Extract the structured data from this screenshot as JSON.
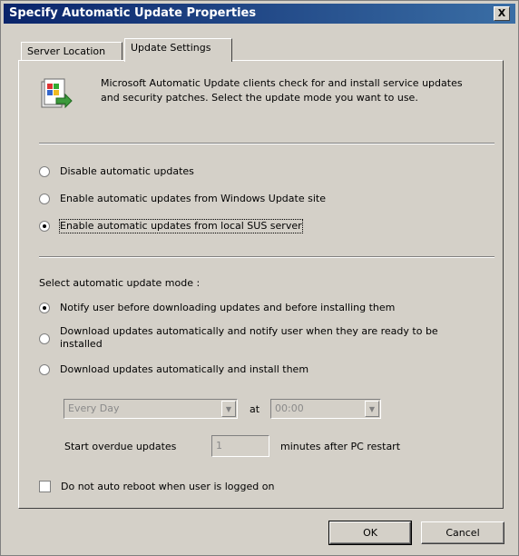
{
  "window": {
    "title": "Specify Automatic Update Properties",
    "close_label": "X"
  },
  "tabs": [
    {
      "label": "Server Location",
      "active": false
    },
    {
      "label": "Update Settings",
      "active": true
    }
  ],
  "intro": {
    "icon": "windows-update-icon",
    "text": "Microsoft Automatic Update clients check for and install service updates and security patches. Select the update mode you want to use."
  },
  "source_options": [
    {
      "label": "Disable automatic updates",
      "checked": false
    },
    {
      "label": "Enable automatic updates from Windows Update site",
      "checked": false
    },
    {
      "label": "Enable automatic updates from local SUS server",
      "checked": true
    }
  ],
  "mode_section": {
    "label": "Select automatic update mode :",
    "options": [
      {
        "label": "Notify user before downloading updates and before installing them",
        "checked": true
      },
      {
        "label": "Download updates automatically and notify user when they are ready to be installed",
        "checked": false
      },
      {
        "label": "Download updates automatically and install them",
        "checked": false
      }
    ]
  },
  "schedule": {
    "day_value": "Every Day",
    "at_label": "at",
    "time_value": "00:00",
    "overdue_label": "Start overdue updates",
    "overdue_value": "1",
    "overdue_suffix": "minutes after PC restart"
  },
  "no_reboot": {
    "label": "Do not auto reboot when user is logged on",
    "checked": false
  },
  "buttons": {
    "ok": "OK",
    "cancel": "Cancel"
  }
}
